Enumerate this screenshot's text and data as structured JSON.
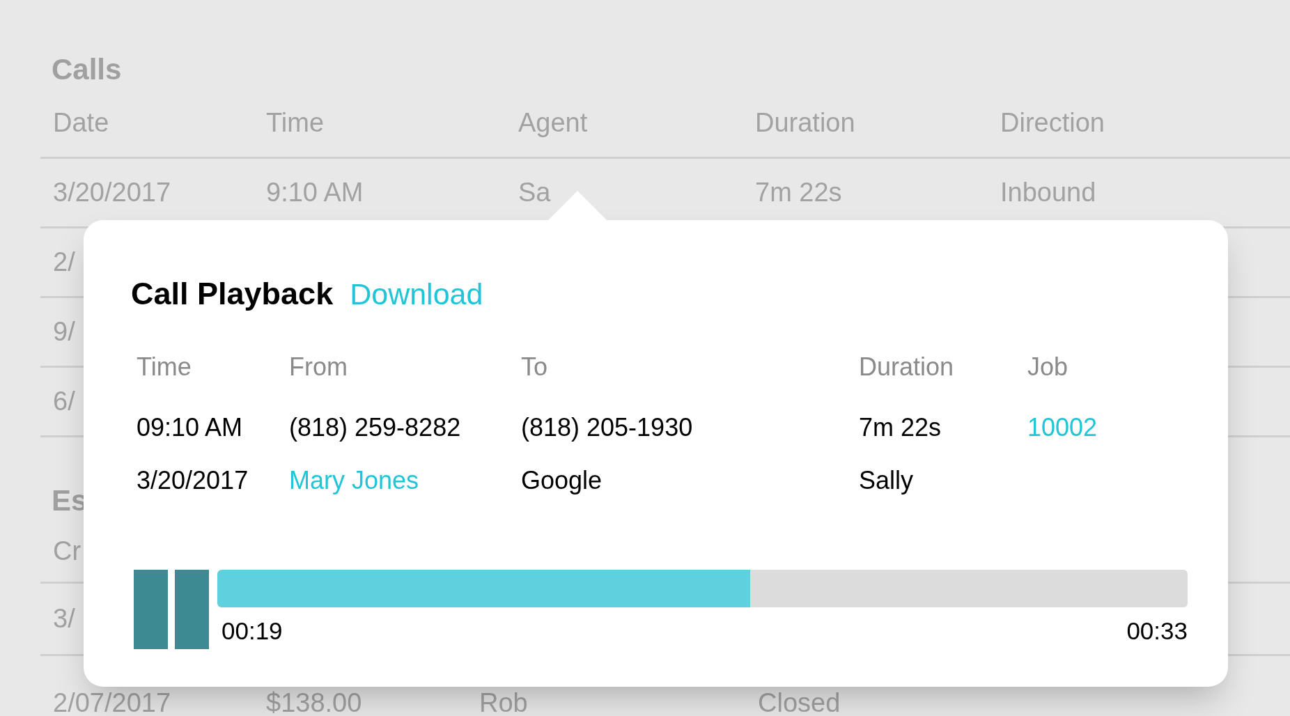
{
  "background": {
    "title": "Calls",
    "columns": [
      "Date",
      "Time",
      "Agent",
      "Duration",
      "Direction"
    ],
    "rows": [
      [
        "3/20/2017",
        "9:10 AM",
        "Sa",
        "7m 22s",
        "Inbound"
      ],
      [
        "2/",
        "",
        "",
        "",
        ""
      ],
      [
        "9/",
        "",
        "",
        "",
        ""
      ],
      [
        "6/",
        "",
        "",
        "",
        ""
      ]
    ],
    "section_title": "Es",
    "section_columns": [
      "Cr"
    ],
    "section_rows": [
      [
        "3/",
        "",
        "",
        "",
        ""
      ],
      [
        "2/07/2017",
        "$138.00",
        "Rob",
        "Closed",
        ""
      ]
    ]
  },
  "popup": {
    "title": "Call Playback",
    "download": "Download",
    "columns": [
      "Time",
      "From",
      "To",
      "Duration",
      "Job"
    ],
    "rows": [
      [
        {
          "text": "09:10 AM",
          "link": false
        },
        {
          "text": "(818) 259-8282",
          "link": false
        },
        {
          "text": "(818) 205-1930",
          "link": false
        },
        {
          "text": "7m 22s",
          "link": false
        },
        {
          "text": "10002",
          "link": true
        }
      ],
      [
        {
          "text": "3/20/2017",
          "link": false
        },
        {
          "text": "Mary Jones",
          "link": true
        },
        {
          "text": "Google",
          "link": false
        },
        {
          "text": "Sally",
          "link": false
        }
      ]
    ],
    "player": {
      "playing": true,
      "level": 0.549,
      "elapsed": "00:19",
      "total": "00:33"
    }
  }
}
